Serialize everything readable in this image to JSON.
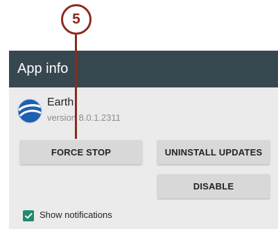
{
  "callout": {
    "number": "5"
  },
  "app_bar": {
    "title": "App info"
  },
  "app": {
    "name": "Earth",
    "version": "version 8.0.1.2311",
    "icon": "earth-app-icon"
  },
  "buttons": {
    "force_stop": "FORCE STOP",
    "uninstall_updates": "UNINSTALL UPDATES",
    "disable": "DISABLE"
  },
  "notifications": {
    "label": "Show notifications",
    "checked": true
  },
  "colors": {
    "callout": "#8a2a1e",
    "app_bar": "#37474f",
    "checkbox": "#1e8c6e",
    "screen_background": "#ebebeb",
    "button": "#d8d8d8"
  }
}
